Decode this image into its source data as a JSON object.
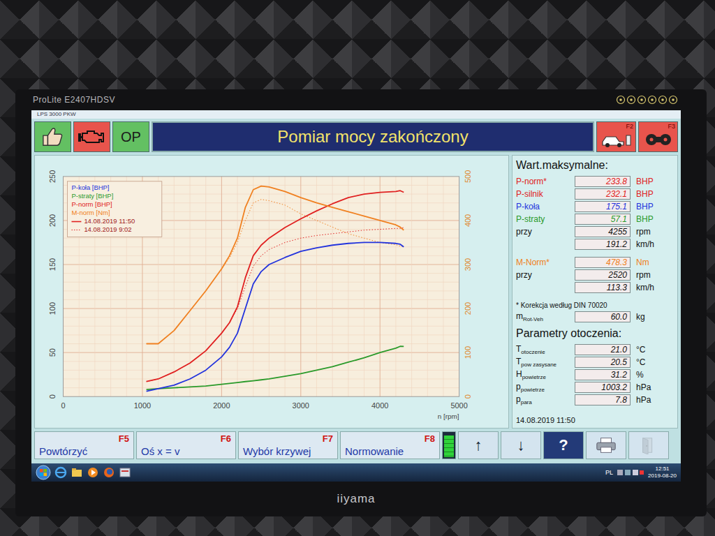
{
  "monitor": {
    "model": "ProLite E2407HDSV",
    "brand": "iiyama"
  },
  "app": {
    "title": "LPS 3000 PKW"
  },
  "toolbar": {
    "left": [
      {
        "kind": "thumbs-up"
      },
      {
        "kind": "engine"
      },
      {
        "kind": "text",
        "label": "OP"
      }
    ],
    "title": "Pomiar mocy zakończony",
    "right": [
      {
        "kind": "car",
        "key": "F2"
      },
      {
        "kind": "rollers",
        "key": "F3"
      }
    ]
  },
  "chart": {
    "y_left_ticks": [
      "0",
      "50",
      "100",
      "150",
      "200",
      "250"
    ],
    "y_right_ticks": [
      "0",
      "100",
      "200",
      "300",
      "400",
      "500"
    ],
    "x_ticks": [
      "0",
      "1000",
      "2000",
      "3000",
      "4000",
      "5000"
    ],
    "x_label": "n [rpm]",
    "legend": [
      {
        "label": "P-koła [BHP]",
        "color": "#2233dd"
      },
      {
        "label": "P-straty [BHP]",
        "color": "#2a9a2a"
      },
      {
        "label": "P-norm [BHP]",
        "color": "#e02020"
      },
      {
        "label": "M-norm [Nm]",
        "color": "#f08020"
      }
    ],
    "runs": [
      {
        "label": "14.08.2019 11:50",
        "kind": "solid"
      },
      {
        "label": "14.08.2019 9:02",
        "kind": "dotted"
      }
    ],
    "x_values": [
      1050,
      1200,
      1400,
      1600,
      1800,
      2000,
      2100,
      2200,
      2300,
      2400,
      2500,
      2600,
      2800,
      3000,
      3200,
      3400,
      3600,
      3800,
      4000,
      4200,
      4255,
      4300
    ],
    "series": [
      {
        "axis": "left",
        "kind": "dotted",
        "color": "#e02020",
        "values": [
          17,
          20,
          28,
          38,
          52,
          72,
          84,
          100,
          125,
          148,
          160,
          167,
          175,
          180,
          183,
          185,
          187,
          189,
          190,
          191,
          191,
          192
        ]
      },
      {
        "axis": "right",
        "kind": "dotted",
        "color": "#f08020",
        "values": [
          120,
          120,
          150,
          195,
          240,
          290,
          315,
          350,
          400,
          440,
          448,
          445,
          435,
          415,
          400,
          385,
          370,
          360,
          350,
          345,
          342,
          340
        ]
      },
      {
        "axis": "left",
        "kind": "solid",
        "color": "#2a9a2a",
        "values": [
          8,
          9,
          10,
          11,
          12,
          14,
          15,
          16,
          17,
          18,
          19,
          20,
          23,
          26,
          30,
          34,
          39,
          44,
          50,
          55,
          57.1,
          57
        ]
      },
      {
        "axis": "left",
        "kind": "solid",
        "color": "#2233dd",
        "values": [
          6,
          9,
          13,
          20,
          30,
          45,
          56,
          72,
          100,
          128,
          142,
          150,
          158,
          165,
          169,
          172,
          174,
          175.1,
          175,
          174,
          173,
          170
        ]
      },
      {
        "axis": "left",
        "kind": "solid",
        "color": "#e02020",
        "values": [
          17,
          20,
          28,
          38,
          52,
          72,
          84,
          102,
          135,
          160,
          172,
          180,
          192,
          202,
          211,
          219,
          226,
          230,
          232,
          233,
          233.8,
          232
        ]
      },
      {
        "axis": "right",
        "kind": "solid",
        "color": "#f08020",
        "values": [
          120,
          120,
          150,
          195,
          240,
          290,
          320,
          360,
          430,
          470,
          478,
          476,
          466,
          452,
          440,
          430,
          420,
          410,
          400,
          390,
          385,
          378
        ]
      }
    ]
  },
  "max_values": {
    "title": "Wart.maksymalne:",
    "power_rows": [
      {
        "label": "P-norm*",
        "value": "233.8",
        "unit": "BHP",
        "color": "#e02020"
      },
      {
        "label": "P-silnik",
        "value": "232.1",
        "unit": "BHP",
        "color": "#e02020"
      },
      {
        "label": "P-koła",
        "value": "175.1",
        "unit": "BHP",
        "color": "#2233dd"
      },
      {
        "label": "P-straty",
        "value": "57.1",
        "unit": "BHP",
        "color": "#2a9a2a"
      },
      {
        "label": "przy",
        "value": "4255",
        "unit": "rpm",
        "color": "#111111"
      },
      {
        "label": "",
        "value": "191.2",
        "unit": "km/h",
        "color": "#111111"
      }
    ],
    "torque_rows": [
      {
        "label": "M-Norm*",
        "value": "478.3",
        "unit": "Nm",
        "color": "#f08020"
      },
      {
        "label": "przy",
        "value": "2520",
        "unit": "rpm",
        "color": "#111111"
      },
      {
        "label": "",
        "value": "113.3",
        "unit": "km/h",
        "color": "#111111"
      }
    ]
  },
  "footnote": "* Korekcja według DIN 70020",
  "mass": {
    "sym": "m",
    "sub": "Rot-Veh",
    "value": "60.0",
    "unit": "kg"
  },
  "environment": {
    "title": "Parametry otoczenia:",
    "rows": [
      {
        "sym": "T",
        "sub": "otoczenie",
        "value": "21.0",
        "unit": "°C"
      },
      {
        "sym": "T",
        "sub": "pow zasysane",
        "value": "20.5",
        "unit": "°C"
      },
      {
        "sym": "H",
        "sub": "powietrze",
        "value": "31.2",
        "unit": "%"
      },
      {
        "sym": "p",
        "sub": "powietrze",
        "value": "1003.2",
        "unit": "hPa"
      },
      {
        "sym": "p",
        "sub": "para",
        "value": "7.8",
        "unit": "hPa"
      }
    ]
  },
  "measured_at": "14.08.2019 11:50",
  "function_keys": [
    {
      "label": "Powtórzyć",
      "key": "F5"
    },
    {
      "label": "Oś x = v",
      "key": "F6"
    },
    {
      "label": "Wybór krzywej",
      "key": "F7"
    },
    {
      "label": "Normowanie",
      "key": "F8"
    }
  ],
  "nav": [
    {
      "kind": "indicator",
      "level": 0.9,
      "disabled": false
    },
    {
      "kind": "up",
      "label": "↑",
      "disabled": false
    },
    {
      "kind": "down",
      "label": "↓",
      "disabled": false
    },
    {
      "kind": "help",
      "label": "?",
      "disabled": false
    },
    {
      "kind": "print",
      "disabled": false
    },
    {
      "kind": "exit",
      "disabled": true
    }
  ],
  "taskbar": {
    "language": "PL",
    "time": "12:51",
    "date": "2019-08-20"
  }
}
